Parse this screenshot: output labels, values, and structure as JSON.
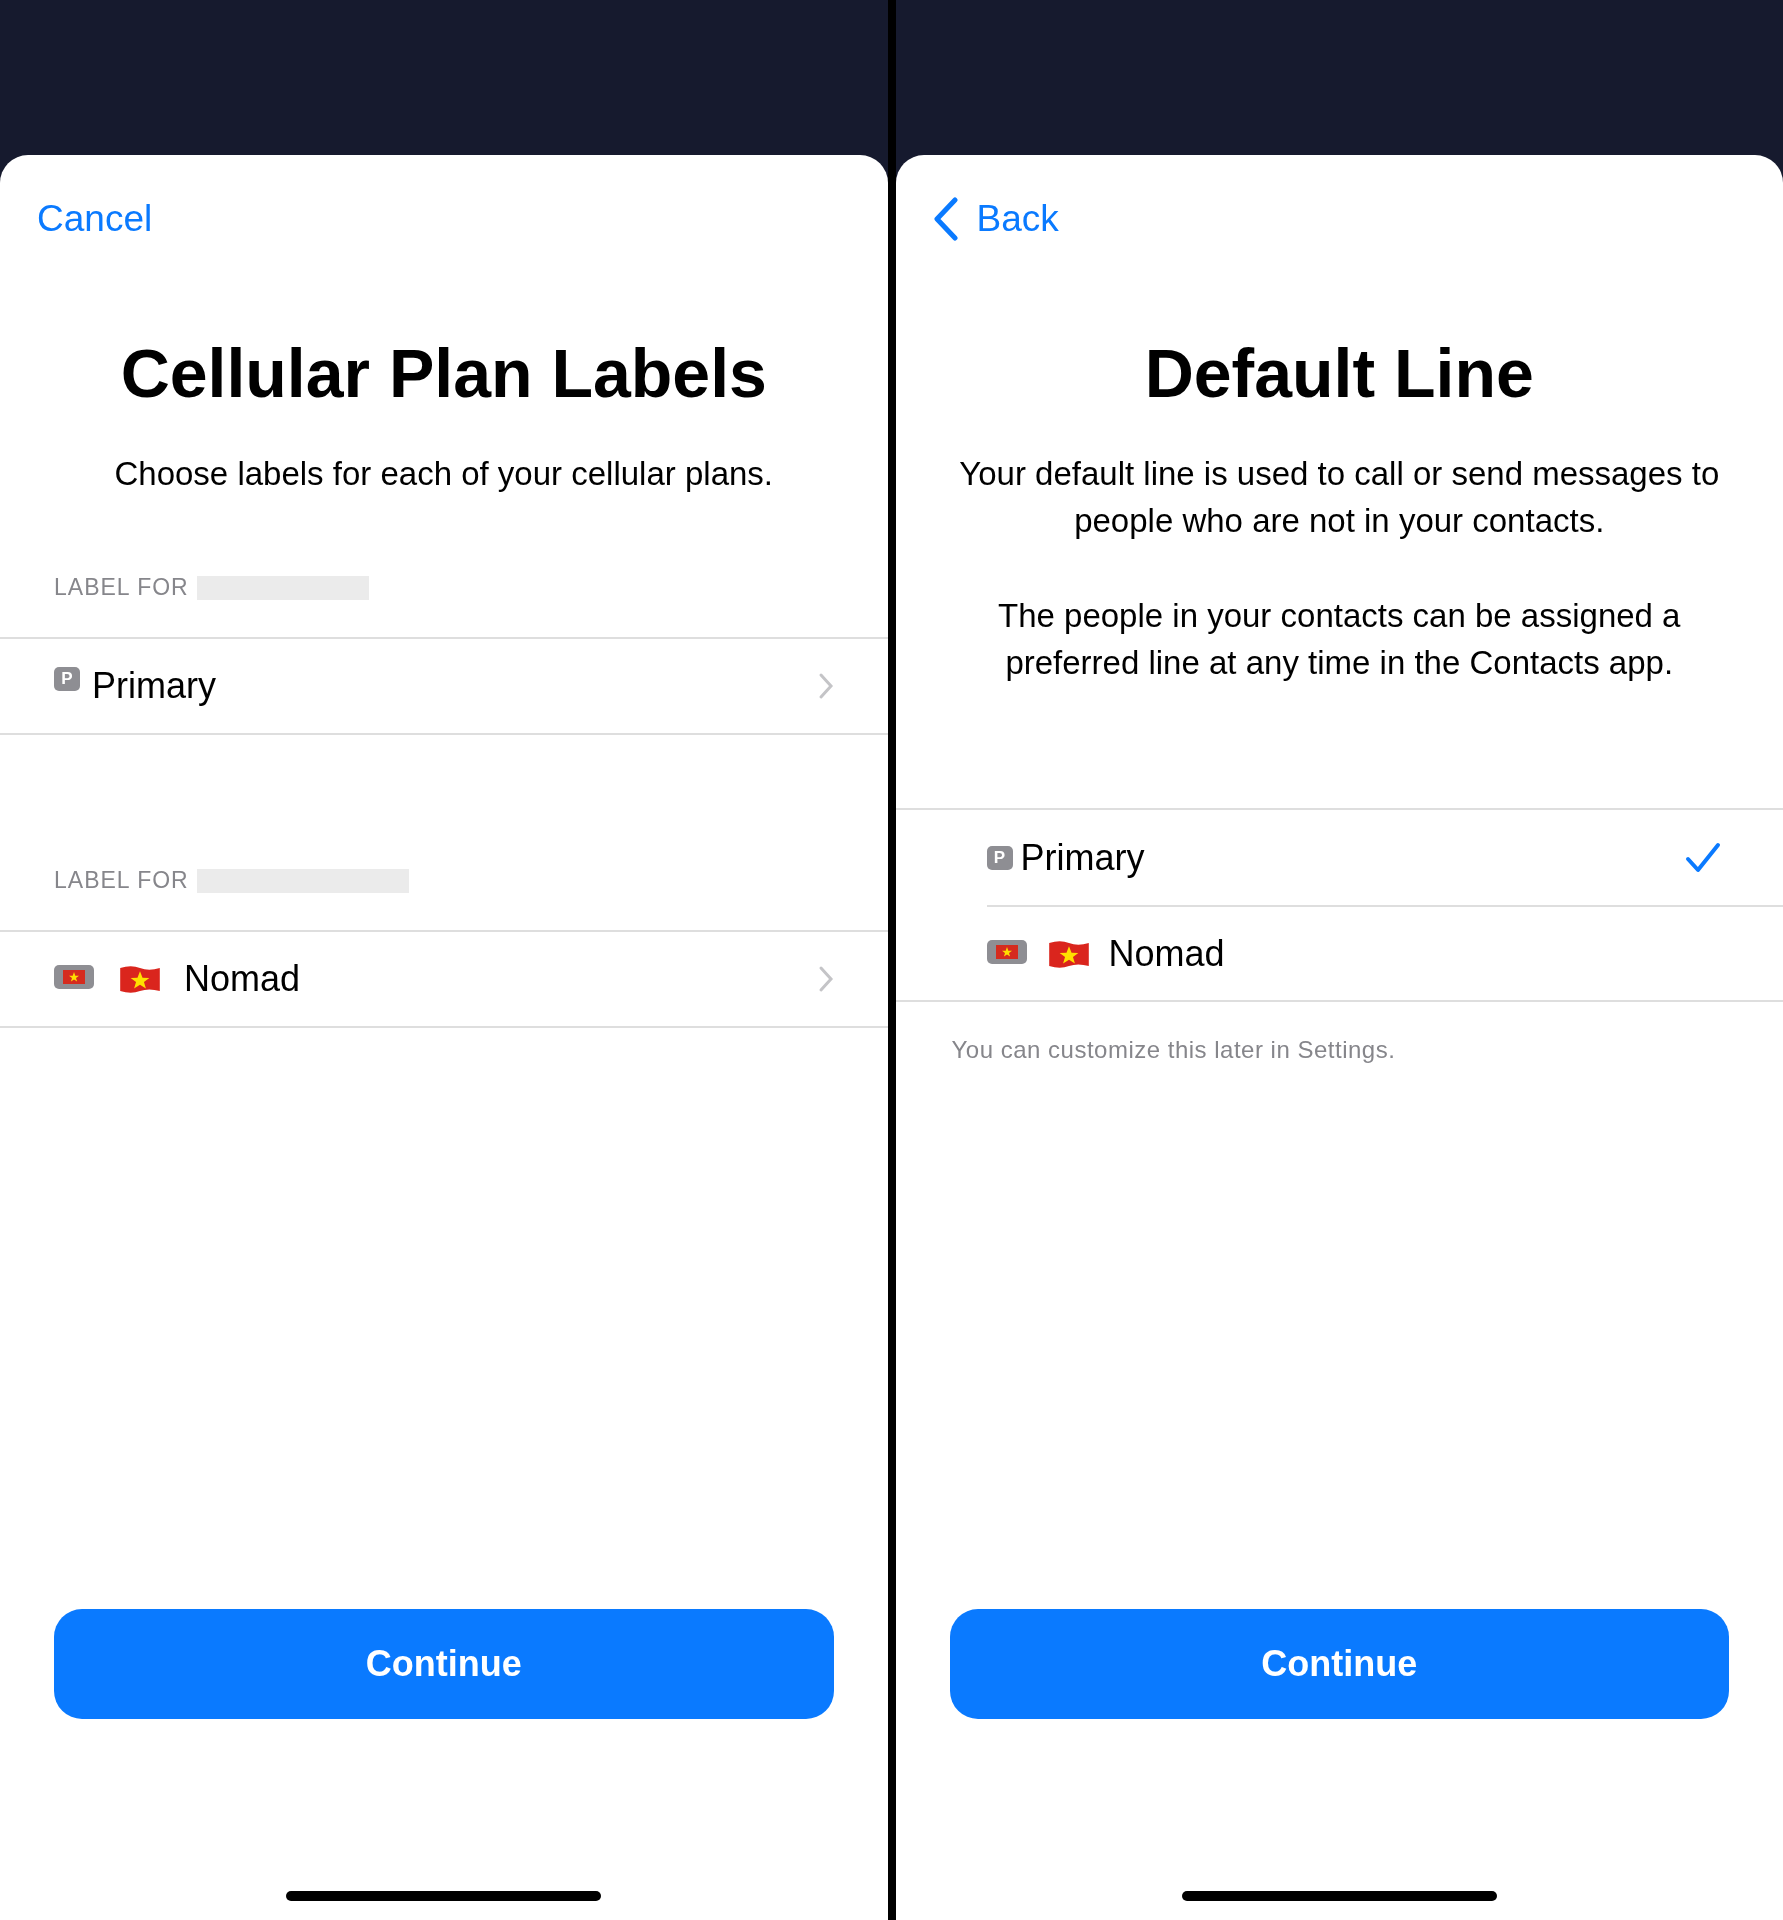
{
  "sheets": [
    {
      "nav": {
        "kind": "text",
        "label": "Cancel"
      },
      "title": "Cellular Plan Labels",
      "paragraphs": [
        "Choose labels for each of your cellular plans."
      ],
      "sections": [
        {
          "header": "LABEL FOR",
          "rows": [
            {
              "kind": "letter",
              "badge": "P",
              "label": "Primary"
            }
          ]
        },
        {
          "header": "LABEL FOR",
          "rows": [
            {
              "kind": "flag",
              "label": "Nomad"
            }
          ]
        }
      ],
      "button": "Continue"
    },
    {
      "nav": {
        "kind": "back",
        "label": "Back"
      },
      "title": "Default Line",
      "paragraphs": [
        "Your default line is used to call or send messages to people who are not in your contacts.",
        "The people in your contacts can be assigned a preferred line at any time in the Contacts app."
      ],
      "options": [
        {
          "kind": "letter",
          "badge": "P",
          "label": "Primary",
          "selected": true
        },
        {
          "kind": "flag",
          "label": "Nomad",
          "selected": false
        }
      ],
      "footnote": "You can customize this later in Settings.",
      "button": "Continue"
    }
  ]
}
